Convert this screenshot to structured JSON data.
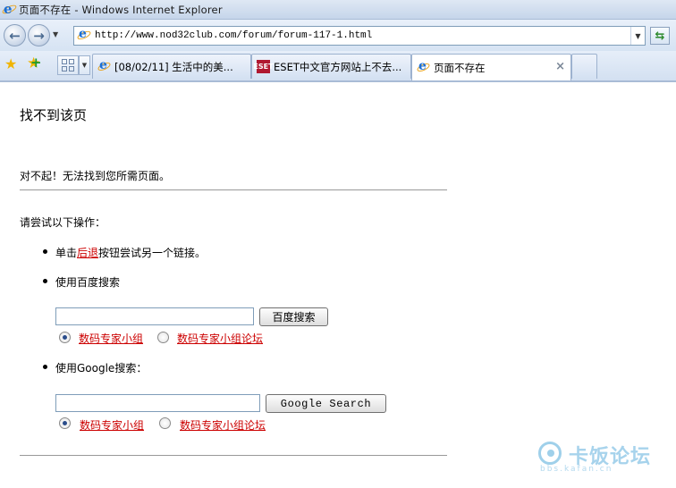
{
  "window": {
    "title": "页面不存在 - Windows Internet Explorer"
  },
  "addressbar": {
    "url": "http://www.nod32club.com/forum/forum-117-1.html"
  },
  "tabs": [
    {
      "label": "[08/02/11] 生活中的美..."
    },
    {
      "label": "ESET中文官方网站上不去...",
      "icon_text": "ESET"
    },
    {
      "label": "页面不存在"
    }
  ],
  "page": {
    "heading": "找不到该页",
    "apology": "对不起！无法找到您所需页面。",
    "try_label": "请尝试以下操作：",
    "bullet1_prefix": "单击",
    "bullet1_link": "后退",
    "bullet1_suffix": "按钮尝试另一个链接。",
    "bullet2": "使用百度搜索",
    "bullet3": "使用Google搜索：",
    "baidu": {
      "input_value": "",
      "button": "百度搜索",
      "option1": "数码专家小组",
      "option2": "数码专家小组论坛"
    },
    "google": {
      "input_value": "",
      "button": "Google Search",
      "option1": "数码专家小组",
      "option2": "数码专家小组论坛"
    }
  },
  "watermark": {
    "text": "卡饭论坛",
    "sub": "bbs.kafan.cn"
  }
}
